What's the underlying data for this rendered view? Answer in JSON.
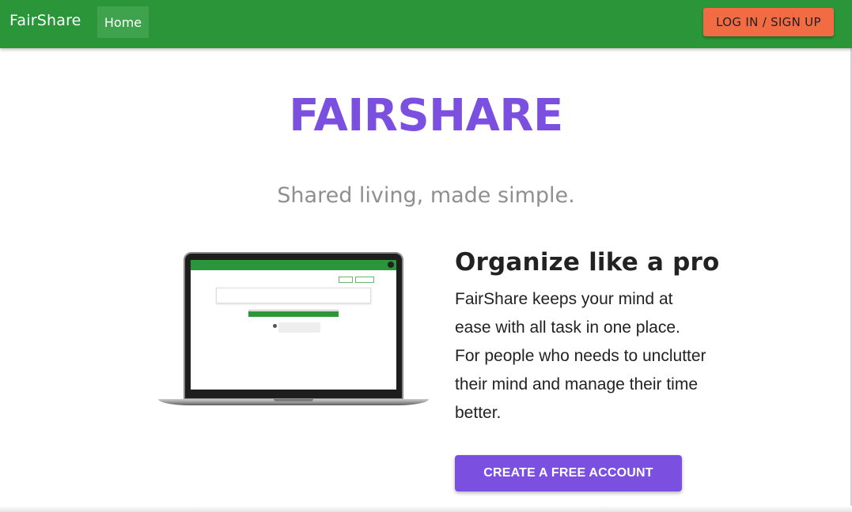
{
  "navbar": {
    "brand": "FairShare",
    "home_label": "Home",
    "login_label": "LOG IN / SIGN UP"
  },
  "hero": {
    "title": "FAIRSHARE",
    "tagline": "Shared living, made simple."
  },
  "feature": {
    "heading": "Organize like a pro",
    "body": "FairShare keeps your mind at ease with all task in one place. For people who needs to unclutter their mind and manage their time better.",
    "cta_label": "CREATE A FREE ACCOUNT",
    "image": "laptop-app-preview"
  },
  "colors": {
    "navbar": "#2a9639",
    "accent": "#7b4fe0",
    "login_button": "#f26c43"
  }
}
